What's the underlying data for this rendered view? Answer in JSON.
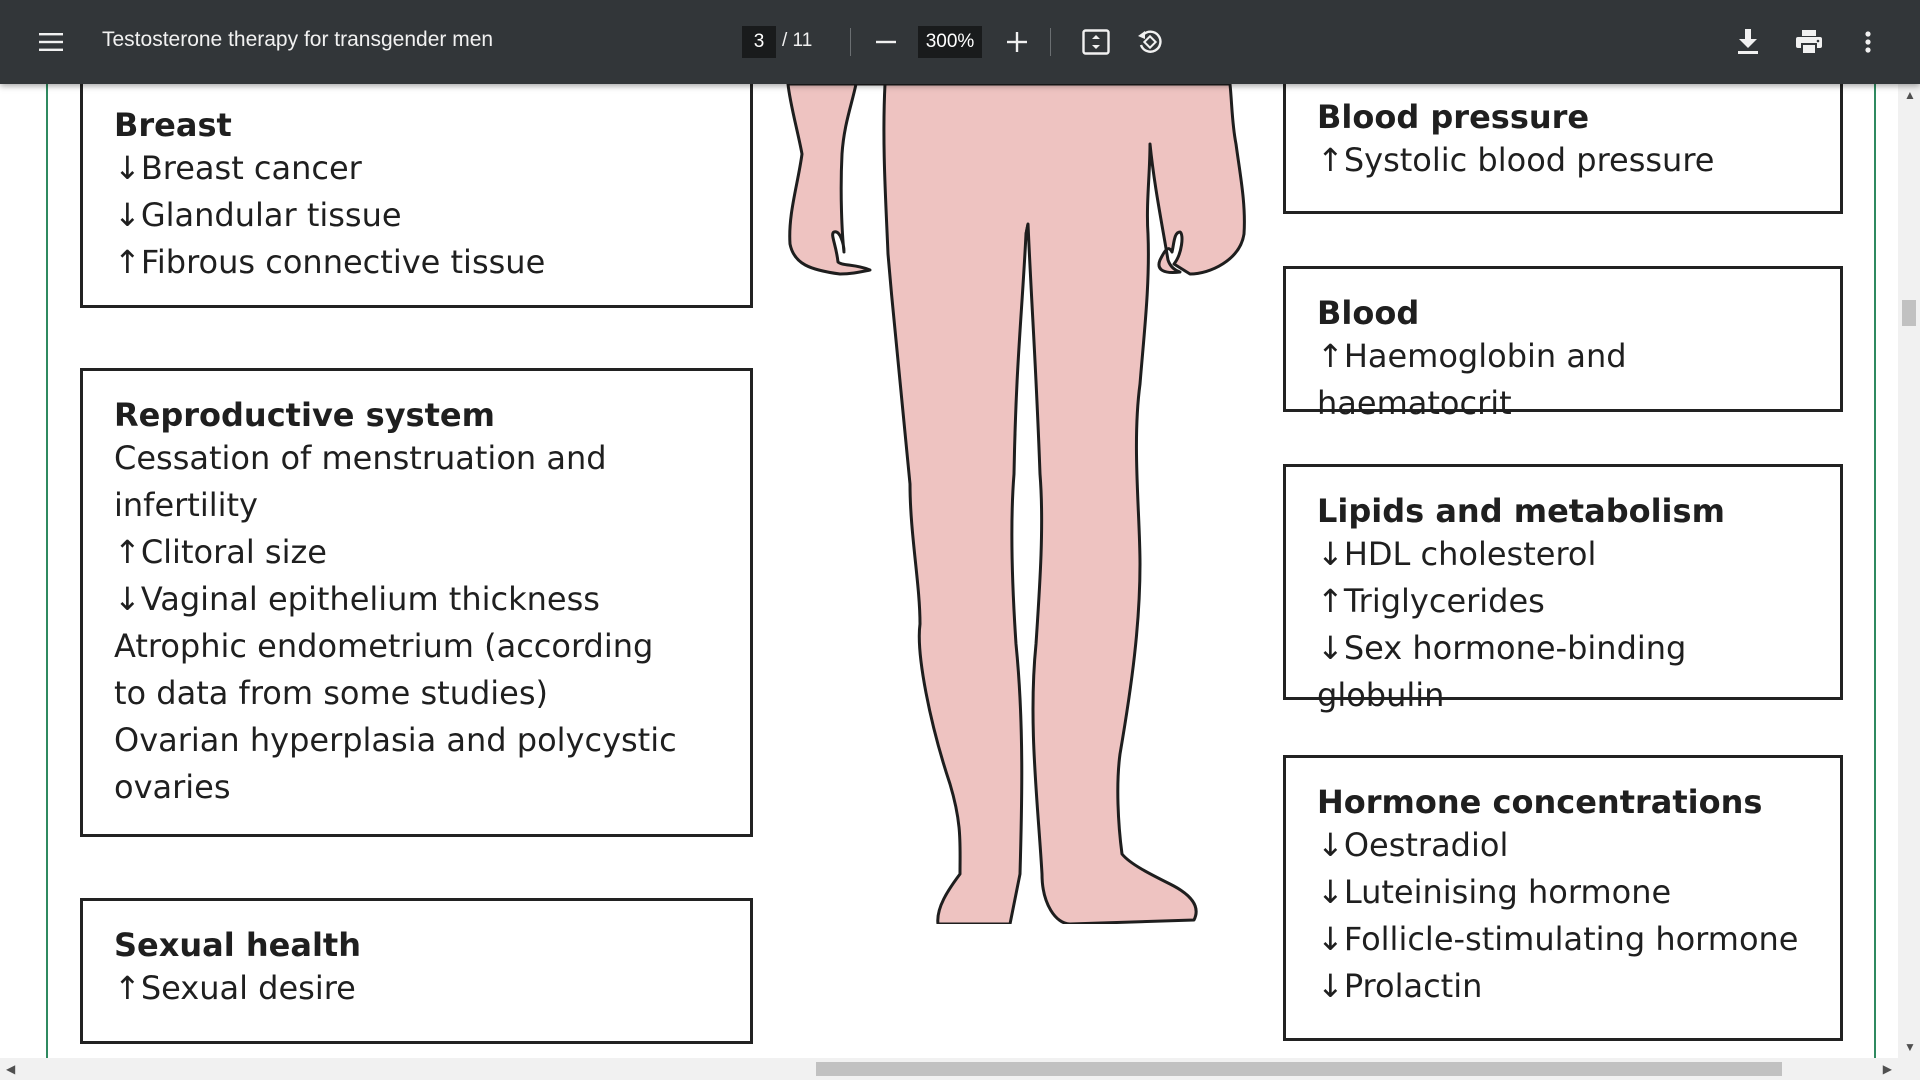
{
  "toolbar": {
    "menu_icon": "hamburger-icon",
    "title": "Testosterone therapy for transgender men",
    "page_current": "3",
    "page_total": "/ 11",
    "zoom": "300%",
    "icons": [
      "zoom-out-icon",
      "zoom-in-icon",
      "fit-page-icon",
      "rotate-icon",
      "download-icon",
      "print-icon",
      "more-vert-icon"
    ]
  },
  "figure": {
    "left_boxes": [
      {
        "title": "Breast",
        "lines": [
          "↓Breast cancer",
          "↓Glandular tissue",
          "↑Fibrous connective tissue"
        ]
      },
      {
        "title": "Reproductive system",
        "lines": [
          "Cessation of menstruation and",
          "infertility",
          "↑Clitoral size",
          "↓Vaginal epithelium thickness",
          "Atrophic endometrium (according",
          "to data from some studies)",
          "Ovarian hyperplasia and polycystic",
          "ovaries"
        ]
      },
      {
        "title": "Sexual health",
        "lines": [
          "↑Sexual desire"
        ]
      }
    ],
    "right_boxes": [
      {
        "title": "Blood pressure",
        "lines": [
          "↑Systolic blood pressure"
        ]
      },
      {
        "title": "Blood",
        "lines": [
          "↑Haemoglobin and haematocrit"
        ]
      },
      {
        "title": "Lipids and metabolism",
        "lines": [
          "↓HDL cholesterol",
          "↑Triglycerides",
          "↓Sex hormone-binding globulin"
        ]
      },
      {
        "title": "Hormone concentrations",
        "lines": [
          "↓Oestradiol",
          "↓Luteinising hormone",
          "↓Follicle-stimulating hormone",
          "↓Prolactin"
        ]
      }
    ],
    "body_fill": "#eec3c1",
    "border_color": "#222222",
    "accent_line_color": "#2f8a60"
  },
  "colors": {
    "toolbar_bg": "#323639",
    "toolbar_text": "#f1f1f1",
    "input_bg": "#191b1c"
  }
}
